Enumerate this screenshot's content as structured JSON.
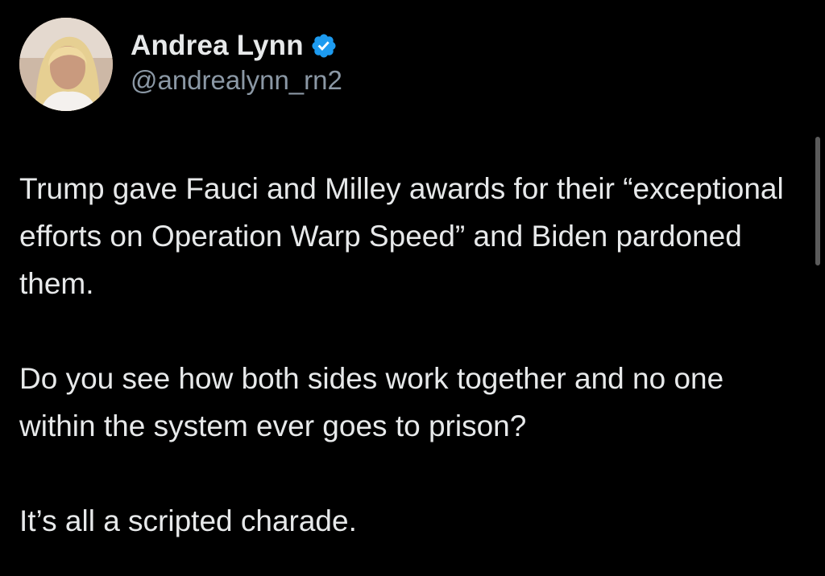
{
  "user": {
    "display_name": "Andrea Lynn",
    "handle": "@andrealynn_rn2",
    "verified_icon": "verified-badge-icon",
    "verified_color": "#1d9bf0"
  },
  "tweet": {
    "paragraphs": [
      "Trump gave Fauci and Milley awards for their “exceptional efforts on Operation Warp Speed” and Biden pardoned them.",
      "Do you see how both sides work together and no one within the system ever goes to prison?",
      "It’s all a scripted charade."
    ]
  },
  "colors": {
    "background": "#000000",
    "text": "#e7e9ea",
    "secondary_text": "#8b98a5"
  }
}
